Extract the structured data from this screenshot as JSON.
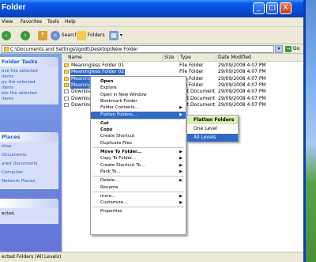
{
  "window": {
    "title": "Folder",
    "min_label": "_",
    "max_label": "□",
    "close_label": "X"
  },
  "menubar": [
    "View",
    "Favorites",
    "Tools",
    "Help"
  ],
  "toolbar": {
    "search_label": "Search",
    "folders_label": "Folders"
  },
  "address": {
    "value": "C:\\Documents and Settings\\lgodt\\Desktop\\New Folder",
    "go_label": "Go"
  },
  "taskpane": {
    "file_tasks_title": "Folder Tasks",
    "file_tasks": [
      "ove the selected",
      "items",
      "py the selected",
      "items",
      "ete the selected",
      "items"
    ],
    "other_places_title": "Places",
    "other_places": [
      "ktop",
      "Documents",
      "ared Documents",
      "Computer",
      "Network Places"
    ],
    "details_lines": [
      "ected."
    ]
  },
  "columns": {
    "name": "Name",
    "size": "Size",
    "type": "Type",
    "date": "Date Modified"
  },
  "files": [
    {
      "name": "Meaningless Folder 01",
      "type": "File Folder",
      "date": "29/09/2008 4:07 PM",
      "selected": false,
      "folder": true
    },
    {
      "name": "Meaningless Folder 02",
      "type": "File Folder",
      "date": "29/09/2008 4:07 PM",
      "selected": true,
      "folder": true
    },
    {
      "name": "Meaningless Folder 03",
      "type": "File Folder",
      "date": "29/09/2008 4:07 PM",
      "selected": true,
      "folder": true
    },
    {
      "name": "Meaningless Folder 04",
      "type": "File Folder",
      "date": "29/09/2008 4:07 PM",
      "selected": true,
      "folder": true
    },
    {
      "name": "Downloaded File 01",
      "type": "Text Document",
      "date": "29/09/2008 4:07 PM",
      "selected": false,
      "folder": false
    },
    {
      "name": "Downloaded File 02",
      "type": "Text Document",
      "date": "29/09/2008 4:07 PM",
      "selected": false,
      "folder": false
    },
    {
      "name": "Downloaded File 03",
      "type": "Text Document",
      "date": "29/09/2008 4:07 PM",
      "selected": false,
      "folder": false
    }
  ],
  "context_menu": [
    {
      "label": "Open",
      "bold": true
    },
    {
      "label": "Explore"
    },
    {
      "label": "Open in New Window"
    },
    {
      "label": "Bookmark Folder"
    },
    {
      "label": "Folder Contents...",
      "arrow": true
    },
    {
      "label": "Flatten Folders...",
      "arrow": true,
      "highlight": true
    },
    {
      "sep": true
    },
    {
      "label": "Cut",
      "bold": true
    },
    {
      "label": "Copy",
      "bold": true
    },
    {
      "label": "Create Shortcut"
    },
    {
      "label": "Duplicate Files"
    },
    {
      "sep": true
    },
    {
      "label": "Move To Folder...",
      "bold": true,
      "arrow": true
    },
    {
      "label": "Copy To Folder...",
      "arrow": true
    },
    {
      "label": "Create Shortcut To...",
      "arrow": true
    },
    {
      "label": "Pack To...",
      "arrow": true
    },
    {
      "sep": true
    },
    {
      "label": "Delete...",
      "arrow": true
    },
    {
      "label": "Rename"
    },
    {
      "sep": true
    },
    {
      "label": "more...",
      "arrow": true
    },
    {
      "label": "Customize...",
      "arrow": true
    },
    {
      "sep": true
    },
    {
      "label": "Properties"
    }
  ],
  "submenu": [
    {
      "label": "Flatten Folders",
      "bold": true
    },
    {
      "label": "One Level"
    },
    {
      "label": "All Levels",
      "highlight": true
    }
  ],
  "status": {
    "text": "ected Folders (All Levels)"
  }
}
